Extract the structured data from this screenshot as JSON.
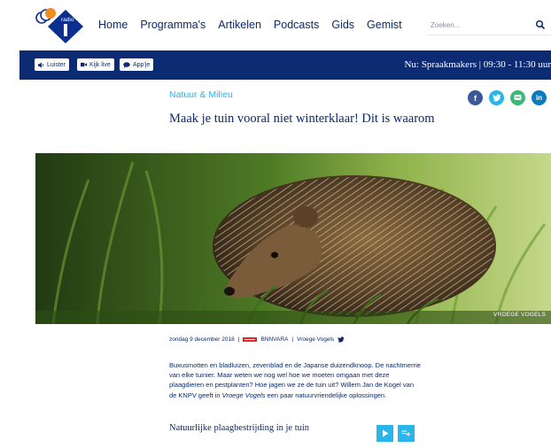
{
  "nav": {
    "logo_label": "radio",
    "items": [
      "Home",
      "Programma's",
      "Artikelen",
      "Podcasts",
      "Gids",
      "Gemist"
    ],
    "search_placeholder": "Zoeken..."
  },
  "bar": {
    "listen_label": "Luister",
    "watch_label": "Kijk live",
    "app_label": "App'je",
    "now_playing": "Nu: Spraakmakers  |  09:30 - 11:30 uur"
  },
  "article": {
    "category": "Natuur & Milieu",
    "title": "Maak je tuin vooral niet winterklaar! Dit is waarom",
    "image_credit": "VROEGE VOGELS",
    "date": "zondag 9 december 2018",
    "broadcaster": "BNNVARA",
    "program": "Vroege Vogels",
    "lead_part1": "Buxusmotten en bladluizen, zevenblad en de Japanse duizendknoop. De nachtmerrie van elke tuinier. Maar weten we nog wel hoe we moeten omgaan met deze plaagdieren en pestplanten? Hoe jagen we ze de tuin uit? Willem Jan de Kogel van de KNPV geeft in ",
    "lead_italic": "Vroege Vogels",
    "lead_part2": " een paar natuurvriendelijke oplossingen.",
    "subhead": "Natuurlijke plaagbestrijding in je tuin"
  },
  "share": [
    {
      "name": "facebook",
      "glyph": "f",
      "color": "#3b5998"
    },
    {
      "name": "twitter",
      "glyph": "t",
      "color": "#28b5e9"
    },
    {
      "name": "whatsapp",
      "glyph": "w",
      "color": "#3cb878"
    },
    {
      "name": "linkedin",
      "glyph": "in",
      "color": "#0a7bbf"
    }
  ],
  "colors": {
    "navy": "#0d2b72",
    "accent": "#28b5e9",
    "logo_blue": "#0b2f8f",
    "logo_orange": "#f28c1e"
  }
}
